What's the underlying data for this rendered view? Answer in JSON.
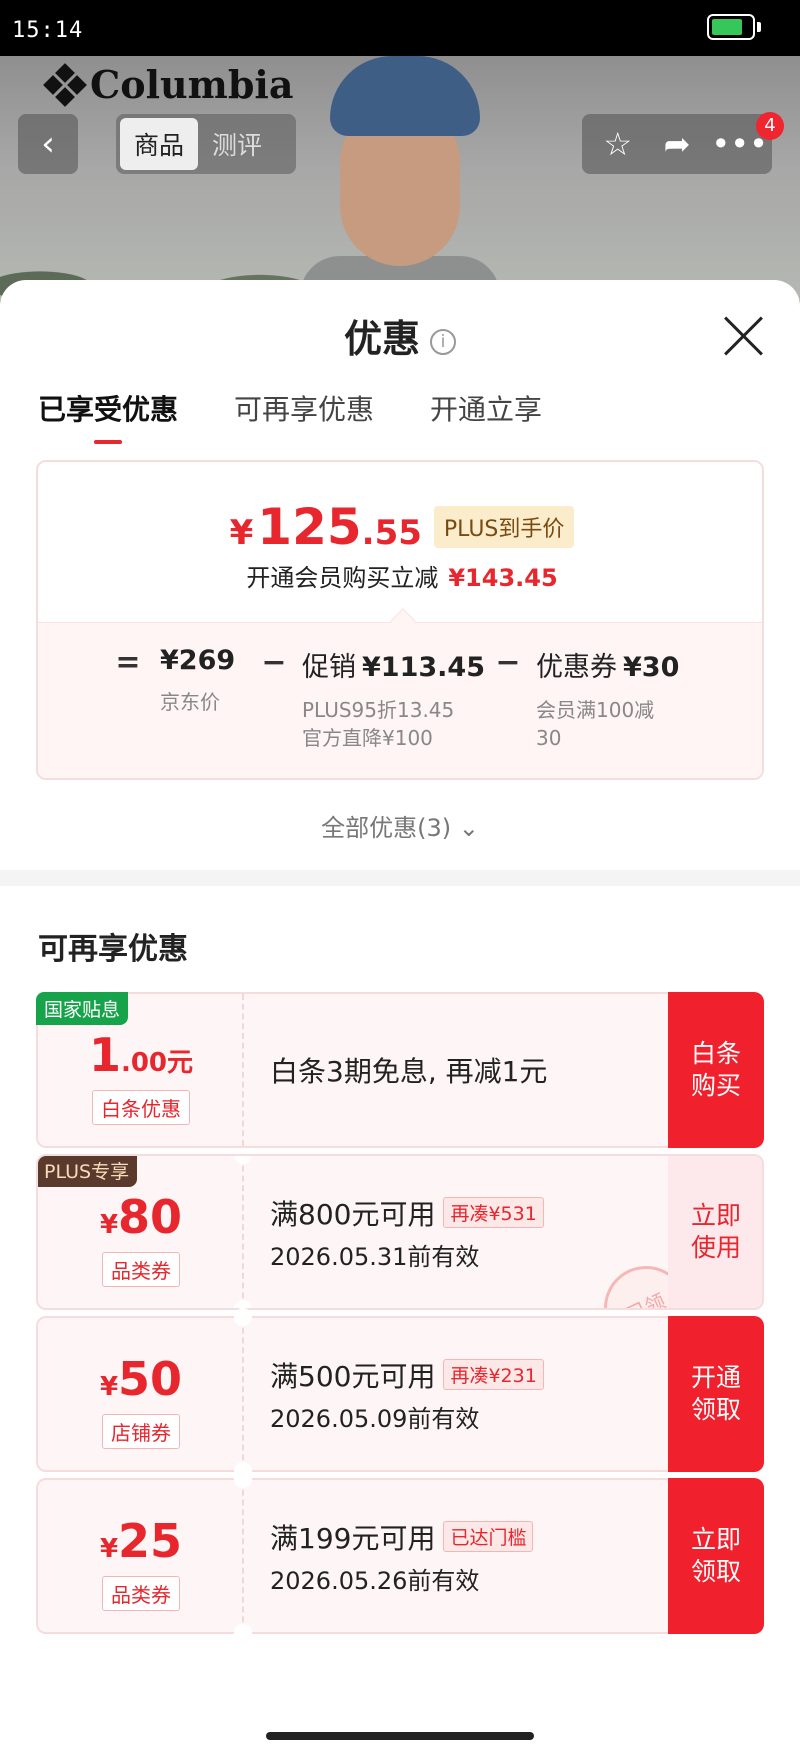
{
  "status_bar": {
    "time": "15:14"
  },
  "header": {
    "brand": "Columbia",
    "tabs": [
      "商品",
      "测评"
    ],
    "badge_count": "4"
  },
  "sheet": {
    "title": "优惠",
    "tabs": [
      "已享受优惠",
      "可再享优惠",
      "开通立享"
    ],
    "price": {
      "currency": "¥",
      "integer": "125",
      "decimal": ".55",
      "tag": "PLUS到手价",
      "subtitle": "开通会员购买立减",
      "saving": "¥143.45"
    },
    "formula": {
      "equals": "=",
      "minus": "−",
      "items": [
        {
          "label": "",
          "value": "¥269",
          "notes": [
            "京东价"
          ]
        },
        {
          "label": "促销",
          "value": "¥113.45",
          "notes": [
            "PLUS95折13.45",
            "官方直降¥100"
          ]
        },
        {
          "label": "优惠券",
          "value": "¥30",
          "notes": [
            "会员满100减",
            "30"
          ]
        }
      ]
    },
    "all_offers": "全部优惠(3)",
    "section_title": "可再享优惠",
    "coupons": [
      {
        "corner": "国家贴息",
        "amount_main": "1",
        "amount_small": ".00元",
        "type": "白条优惠",
        "line1": "白条3期免息, 再减1元",
        "tag": "",
        "line2": "",
        "button": [
          "白条",
          "购买"
        ]
      },
      {
        "corner": "PLUS专享",
        "currency": "¥",
        "amount_main": "80",
        "type": "品类券",
        "line1": "满800元可用",
        "tag": "再凑¥531",
        "line2": "2026.05.31前有效",
        "button": [
          "立即",
          "使用"
        ],
        "stamp": "已领"
      },
      {
        "currency": "¥",
        "amount_main": "50",
        "type": "店铺券",
        "line1": "满500元可用",
        "tag": "再凑¥231",
        "line2": "2026.05.09前有效",
        "button": [
          "开通",
          "领取"
        ]
      },
      {
        "currency": "¥",
        "amount_main": "25",
        "type": "品类券",
        "line1": "满199元可用",
        "tag": "已达门槛",
        "line2": "2026.05.26前有效",
        "button": [
          "立即",
          "领取"
        ]
      }
    ]
  }
}
